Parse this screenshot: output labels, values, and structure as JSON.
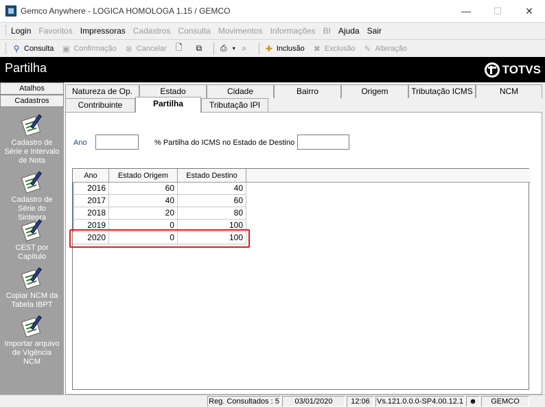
{
  "window": {
    "title": "Gemco Anywhere - LOGICA HOMOLOGA 1.15 / GEMCO",
    "minimize": "—",
    "maximize": "☐",
    "close": "✕"
  },
  "menu": [
    {
      "label": "Login",
      "enabled": true
    },
    {
      "label": "Favoritos",
      "enabled": false
    },
    {
      "label": "Impressoras",
      "enabled": true
    },
    {
      "label": "Cadastros",
      "enabled": false
    },
    {
      "label": "Consulta",
      "enabled": false
    },
    {
      "label": "Movimentos",
      "enabled": false
    },
    {
      "label": "Informações",
      "enabled": false
    },
    {
      "label": "BI",
      "enabled": false
    },
    {
      "label": "Ajuda",
      "enabled": true
    },
    {
      "label": "Sair",
      "enabled": true
    }
  ],
  "toolbar": {
    "consulta": "Consulta",
    "confirmacao": "Confirmação",
    "cancelar": "Cancelar",
    "inclusao": "Inclusão",
    "exclusao": "Exclusão",
    "alteracao": "Alteração"
  },
  "header": {
    "title": "Partilha",
    "brand": "TOTVS"
  },
  "sidebar": {
    "tabs": [
      "Atalhos",
      "Cadastros"
    ],
    "items": [
      {
        "label": "Cadastro de Série e Intervalo de Nota"
      },
      {
        "label": "Cadastro de Série do Sintegra"
      },
      {
        "label": "CEST por Capítulo"
      },
      {
        "label": "Copiar NCM da Tabela IBPT"
      },
      {
        "label": "Importar arquivo de Vigência NCM"
      }
    ]
  },
  "tabs_row1": [
    "Natureza de Op.",
    "Estado",
    "Cidade",
    "Bairro",
    "Origem",
    "Tributação ICMS",
    "NCM"
  ],
  "tabs_row2": [
    "Contribuinte",
    "Partilha",
    "Tributação IPI"
  ],
  "active_tab": "Partilha",
  "form": {
    "ano_label": "Ano",
    "ano_value": "",
    "partilha_label": "% Partilha do ICMS no Estado de Destino",
    "partilha_value": ""
  },
  "grid": {
    "columns": [
      "Ano",
      "Estado Origem",
      "Estado Destino"
    ],
    "rows": [
      [
        "2016",
        "60",
        "40"
      ],
      [
        "2017",
        "40",
        "60"
      ],
      [
        "2018",
        "20",
        "80"
      ],
      [
        "2019",
        "0",
        "100"
      ],
      [
        "2020",
        "0",
        "100"
      ]
    ],
    "highlighted_row": 4,
    "highlight_color": "#e21b1b"
  },
  "status": {
    "reg": "Reg. Consultados : 5",
    "date": "03/01/2020",
    "time": "12:06",
    "version": "Vs.121.0.0.0-SP4.00.12.1",
    "company": "GEMCO"
  }
}
